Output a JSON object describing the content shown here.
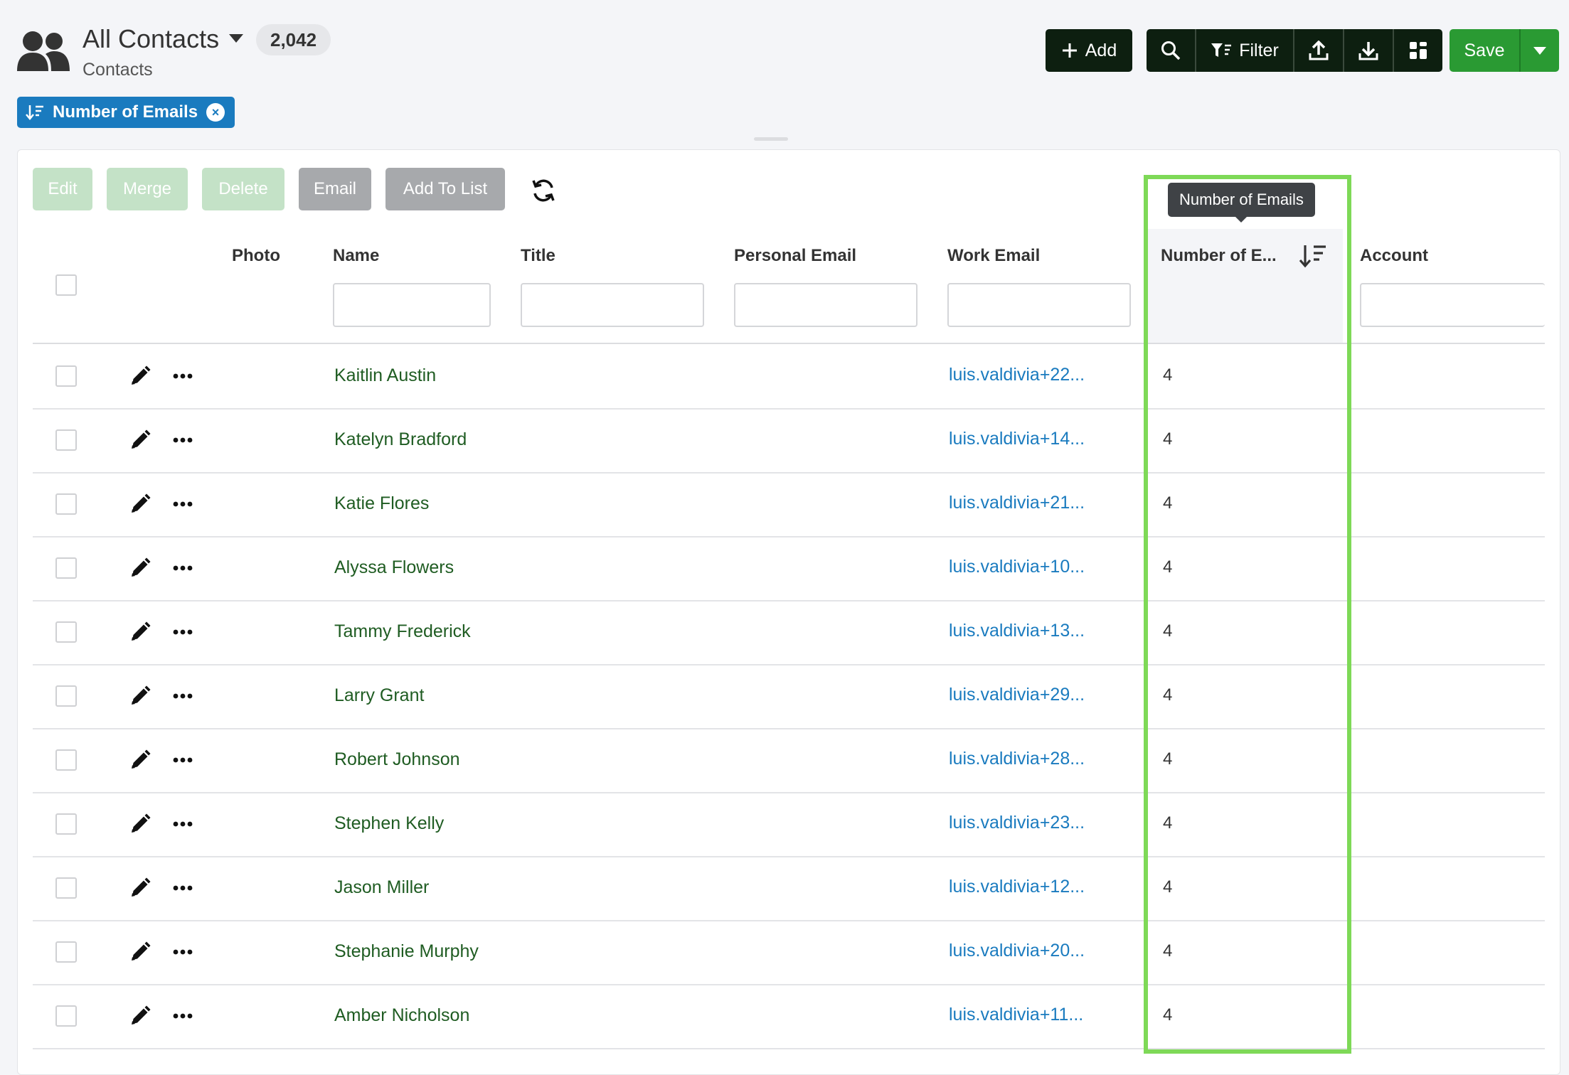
{
  "header": {
    "title": "All Contacts",
    "count": "2,042",
    "subtitle": "Contacts",
    "icon": "contacts-icon"
  },
  "sort_chip": {
    "label": "Number of Emails",
    "icon": "sort-desc-icon",
    "remove_icon": "close-circle-icon"
  },
  "toolbar": {
    "add_label": "Add",
    "filter_label": "Filter",
    "save_label": "Save",
    "icons": [
      "plus-icon",
      "search-icon",
      "filter-icon",
      "upload-icon",
      "download-icon",
      "layout-icon",
      "chevron-down-icon"
    ]
  },
  "actions": {
    "edit": "Edit",
    "merge": "Merge",
    "delete": "Delete",
    "email": "Email",
    "add_to_list": "Add To List"
  },
  "columns": {
    "photo": "Photo",
    "name": "Name",
    "title": "Title",
    "personal_email": "Personal Email",
    "work_email": "Work Email",
    "number_of_emails": "Number of E...",
    "account": "Account"
  },
  "tooltip": "Number of Emails",
  "rows": [
    {
      "name": "Kaitlin Austin",
      "work_email": "luis.valdivia+22...",
      "num": "4"
    },
    {
      "name": "Katelyn Bradford",
      "work_email": "luis.valdivia+14...",
      "num": "4"
    },
    {
      "name": "Katie Flores",
      "work_email": "luis.valdivia+21...",
      "num": "4"
    },
    {
      "name": "Alyssa Flowers",
      "work_email": "luis.valdivia+10...",
      "num": "4"
    },
    {
      "name": "Tammy Frederick",
      "work_email": "luis.valdivia+13...",
      "num": "4"
    },
    {
      "name": "Larry Grant",
      "work_email": "luis.valdivia+29...",
      "num": "4"
    },
    {
      "name": "Robert Johnson",
      "work_email": "luis.valdivia+28...",
      "num": "4"
    },
    {
      "name": "Stephen Kelly",
      "work_email": "luis.valdivia+23...",
      "num": "4"
    },
    {
      "name": "Jason Miller",
      "work_email": "luis.valdivia+12...",
      "num": "4"
    },
    {
      "name": "Stephanie Murphy",
      "work_email": "luis.valdivia+20...",
      "num": "4"
    },
    {
      "name": "Amber Nicholson",
      "work_email": "luis.valdivia+11...",
      "num": "4"
    }
  ],
  "colors": {
    "accent_blue": "#1a7bbf",
    "save_green": "#2a9a33",
    "dark_button": "#0d1f10",
    "highlight_green": "#7ed957",
    "name_green": "#1f5c22"
  }
}
